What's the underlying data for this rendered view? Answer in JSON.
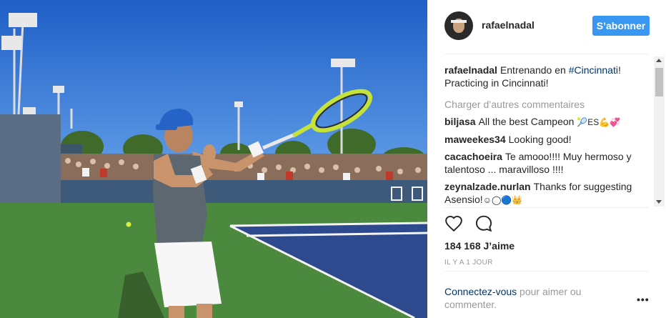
{
  "post": {
    "username": "rafaelnadal",
    "follow_label": "S’abonner"
  },
  "caption": {
    "username": "rafaelnadal",
    "text_before": "Entrenando en ",
    "hashtag": "#Cincinnati",
    "text_after": "! Practicing in Cincinnati!"
  },
  "load_more_label": "Charger d’autres commentaires",
  "comments": [
    {
      "user": "biljasa",
      "text": "All the best Campeon ",
      "emojis": "🎾ES💪💞"
    },
    {
      "user": "maweekes34",
      "text": "Looking good!",
      "emojis": ""
    },
    {
      "user": "cacachoeira",
      "text": "Te amooo!!!! Muy hermoso y talentoso ... maravilloso !!!!",
      "emojis": ""
    },
    {
      "user": "zeynalzade.nurlan",
      "text": "Thanks for suggesting Asensio!",
      "emojis": "☺◯🔵👑"
    }
  ],
  "likes": "184 168 J’aime",
  "time": "IL Y A 1 JOUR",
  "login_prompt": {
    "link": "Connectez-vous",
    "text": " pour aimer ou commenter."
  },
  "more_options": "•••",
  "colors": {
    "accent": "#3897f0",
    "link": "#003569",
    "muted": "#999999",
    "court_blue": "#2e4a8f",
    "court_green": "#4b8a3e",
    "sky": "#2d6fd0"
  },
  "icons": {
    "like": "heart-icon",
    "comment": "speech-bubble-icon",
    "more": "ellipsis-icon"
  }
}
